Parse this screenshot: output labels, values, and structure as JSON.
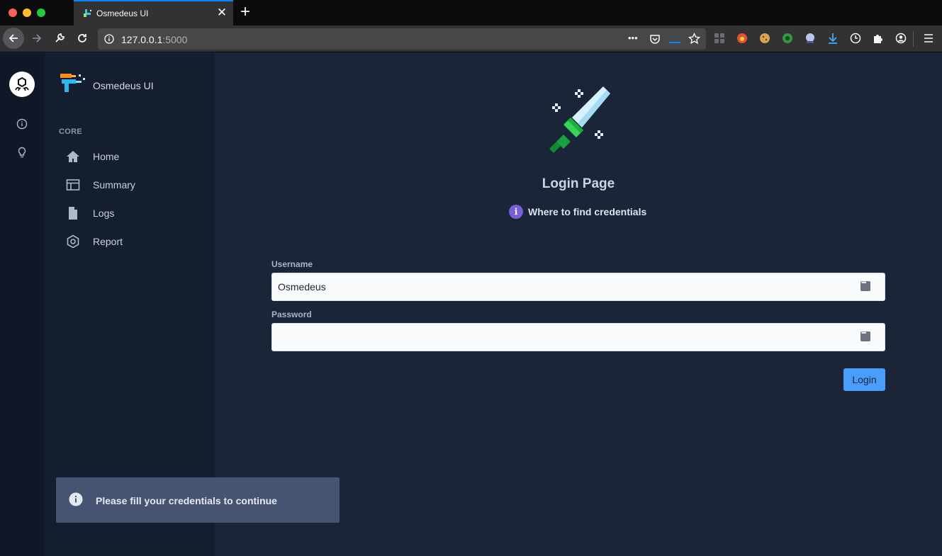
{
  "browser": {
    "tab_title": "Osmedeus UI",
    "tab_close_glyph": "✕",
    "new_tab_glyph": "+",
    "url_host": "127.0.0.1",
    "url_port": ":5000",
    "page_actions_glyph": "•••"
  },
  "rail": {
    "icons": [
      "app-logo-icon",
      "info-icon",
      "lightbulb-icon"
    ]
  },
  "sidebar": {
    "brand_name": "Osmedeus UI",
    "section_label": "CORE",
    "items": [
      {
        "label": "Home",
        "icon": "home-icon"
      },
      {
        "label": "Summary",
        "icon": "table-icon"
      },
      {
        "label": "Logs",
        "icon": "file-icon"
      },
      {
        "label": "Report",
        "icon": "hexagon-icon"
      }
    ]
  },
  "main": {
    "title": "Login Page",
    "help_icon_glyph": "i",
    "help_link": "Where to find credentials",
    "username_label": "Username",
    "username_value": "Osmedeus",
    "password_label": "Password",
    "password_value": "",
    "login_button": "Login"
  },
  "toast": {
    "message": "Please fill your credentials to continue"
  },
  "colors": {
    "accent": "#4a9df8",
    "help_icon": "#7b5fd6",
    "background": "#1b2538"
  }
}
